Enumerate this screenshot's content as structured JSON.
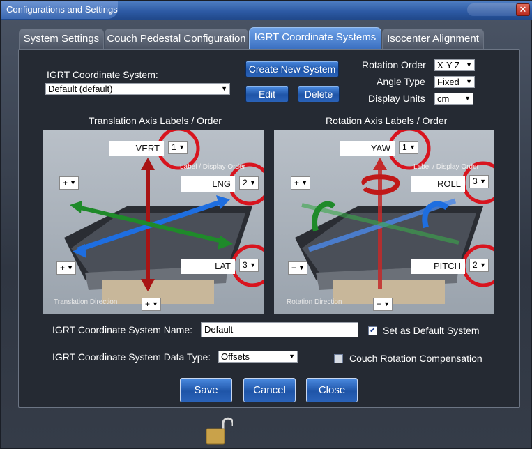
{
  "window": {
    "title": "Configurations and Settings",
    "close_label": "✕"
  },
  "tabs": [
    {
      "label": "System Settings"
    },
    {
      "label": "Couch Pedestal Configuration"
    },
    {
      "label": "IGRT Coordinate Systems"
    },
    {
      "label": "Isocenter Alignment"
    }
  ],
  "coordinate_system": {
    "label": "IGRT Coordinate System:",
    "value": "Default (default)",
    "create_label": "Create New System",
    "edit_label": "Edit",
    "delete_label": "Delete"
  },
  "rotation_order": {
    "label": "Rotation Order",
    "value": "X-Y-Z"
  },
  "angle_type": {
    "label": "Angle Type",
    "value": "Fixed"
  },
  "display_units": {
    "label": "Display Units",
    "value": "cm"
  },
  "translation": {
    "title": "Translation Axis Labels / Order",
    "direction_label": "Translation Direction",
    "hint": "Label / Display Order",
    "axes": [
      {
        "label": "VERT",
        "order": "1"
      },
      {
        "label": "LNG",
        "order": "2"
      },
      {
        "label": "LAT",
        "order": "3"
      }
    ],
    "signs": [
      "+",
      "+",
      "+"
    ]
  },
  "rotation": {
    "title": "Rotation Axis Labels / Order",
    "direction_label": "Rotation Direction",
    "hint": "Label / Display Order",
    "axes": [
      {
        "label": "YAW",
        "order": "1"
      },
      {
        "label": "ROLL",
        "order": "3"
      },
      {
        "label": "PITCH",
        "order": "2"
      }
    ],
    "signs": [
      "+",
      "+",
      "+"
    ]
  },
  "system_name": {
    "label": "IGRT Coordinate System Name:",
    "value": "Default"
  },
  "default_system": {
    "label": "Set as Default System",
    "checked": true
  },
  "data_type": {
    "label": "IGRT Coordinate System Data Type:",
    "value": "Offsets"
  },
  "couch_comp": {
    "label": "Couch Rotation Compensation",
    "checked": false
  },
  "buttons": {
    "save": "Save",
    "cancel": "Cancel",
    "close": "Close"
  },
  "colors": {
    "accent": "#2f66c0",
    "highlight_ring": "#d8141e",
    "vert_arrow": "#b01818",
    "lng_arrow": "#1e6ee0",
    "lat_arrow": "#1f8a2a"
  }
}
